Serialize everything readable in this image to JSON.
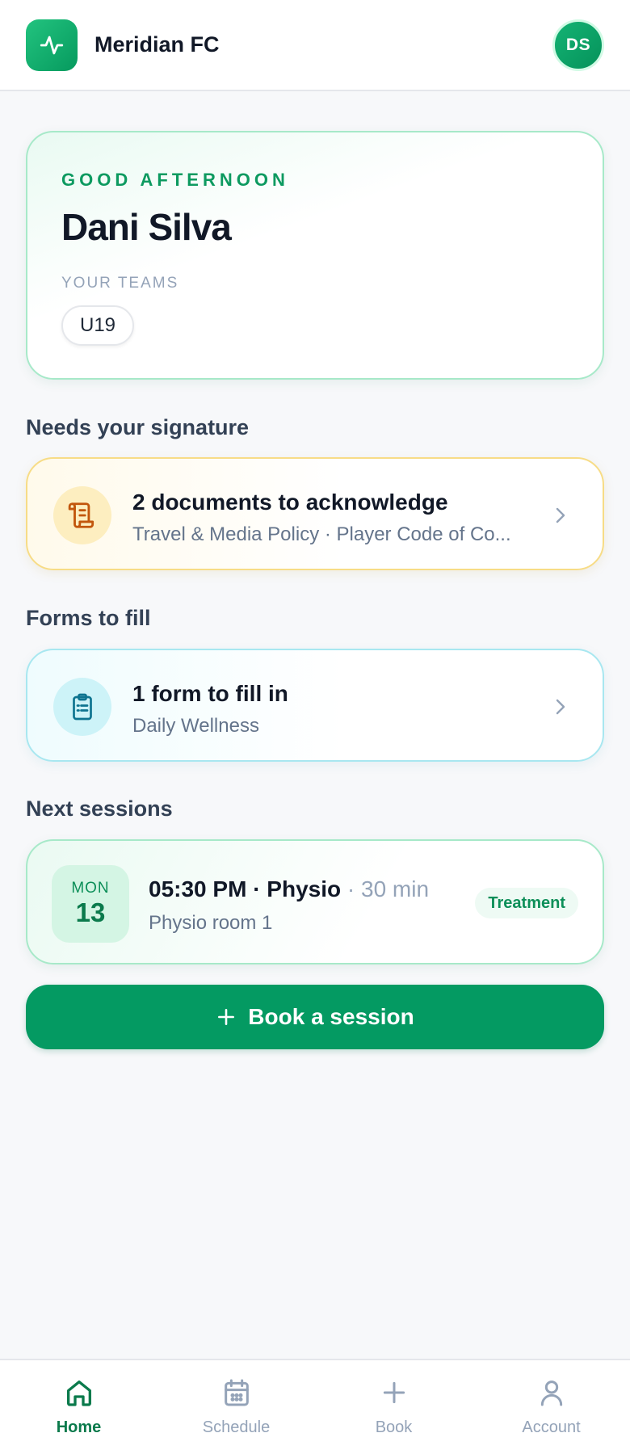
{
  "header": {
    "app_title": "Meridian FC",
    "logo_icon": "activity-icon",
    "avatar_initials": "DS"
  },
  "greeting": {
    "eyebrow": "GOOD AFTERNOON",
    "name": "Dani Silva",
    "teams_label": "YOUR TEAMS",
    "teams": [
      "U19"
    ]
  },
  "signature": {
    "section_title": "Needs your signature",
    "title": "2 documents to acknowledge",
    "subtitle": "Travel & Media Policy · Player Code of Co...",
    "icon": "scroll-icon"
  },
  "forms": {
    "section_title": "Forms to fill",
    "title": "1 form to fill in",
    "subtitle": "Daily Wellness",
    "icon": "clipboard-icon"
  },
  "sessions": {
    "section_title": "Next sessions",
    "items": [
      {
        "dow": "MON",
        "day": "13",
        "time": "05:30 PM",
        "separator": "·",
        "name": "Physio",
        "duration_sep": "·",
        "duration": "30 min",
        "location": "Physio room 1",
        "tag": "Treatment"
      }
    ]
  },
  "book_button": {
    "label": "Book a session",
    "icon": "plus-icon"
  },
  "nav": {
    "items": [
      {
        "label": "Home",
        "icon": "home-icon",
        "active": true
      },
      {
        "label": "Schedule",
        "icon": "calendar-icon",
        "active": false
      },
      {
        "label": "Book",
        "icon": "plus-icon",
        "active": false
      },
      {
        "label": "Account",
        "icon": "user-icon",
        "active": false
      }
    ]
  },
  "colors": {
    "brand": "#049a62",
    "signature_accent": "#f7dc86",
    "form_accent": "#a8e7f0"
  }
}
